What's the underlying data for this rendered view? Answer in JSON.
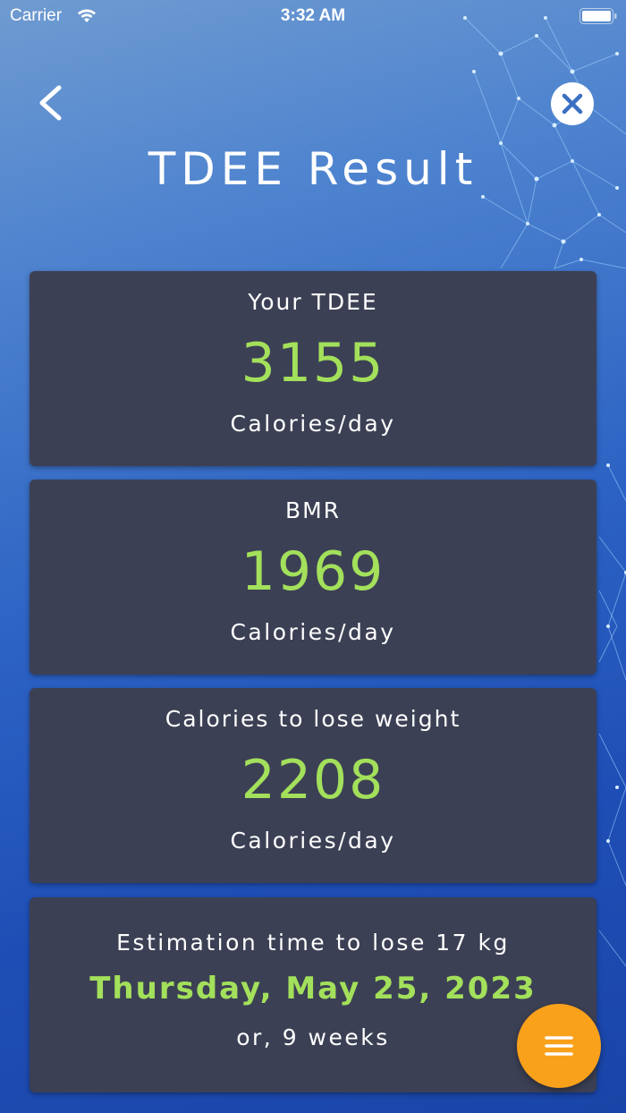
{
  "status_bar": {
    "carrier": "Carrier",
    "time": "3:32 AM",
    "wifi_icon": "wifi-icon",
    "battery_icon": "battery-icon"
  },
  "header": {
    "title": "TDEE Result",
    "back_icon": "chevron-left-icon",
    "close_icon": "close-icon"
  },
  "cards": [
    {
      "label": "Your TDEE",
      "value": "3155",
      "unit": "Calories/day"
    },
    {
      "label": "BMR",
      "value": "1969",
      "unit": "Calories/day"
    },
    {
      "label": "Calories to lose weight",
      "value": "2208",
      "unit": "Calories/day"
    }
  ],
  "estimation": {
    "label": "Estimation time to lose 17 kg",
    "date": "Thursday, May 25, 2023",
    "weeks": "or, 9 weeks"
  },
  "fab": {
    "icon": "menu-icon"
  },
  "colors": {
    "accent_green": "#a3e05b",
    "card_bg": "#3c4054",
    "fab_orange": "#f9a11b",
    "close_icon_blue": "#3a6fc2"
  }
}
